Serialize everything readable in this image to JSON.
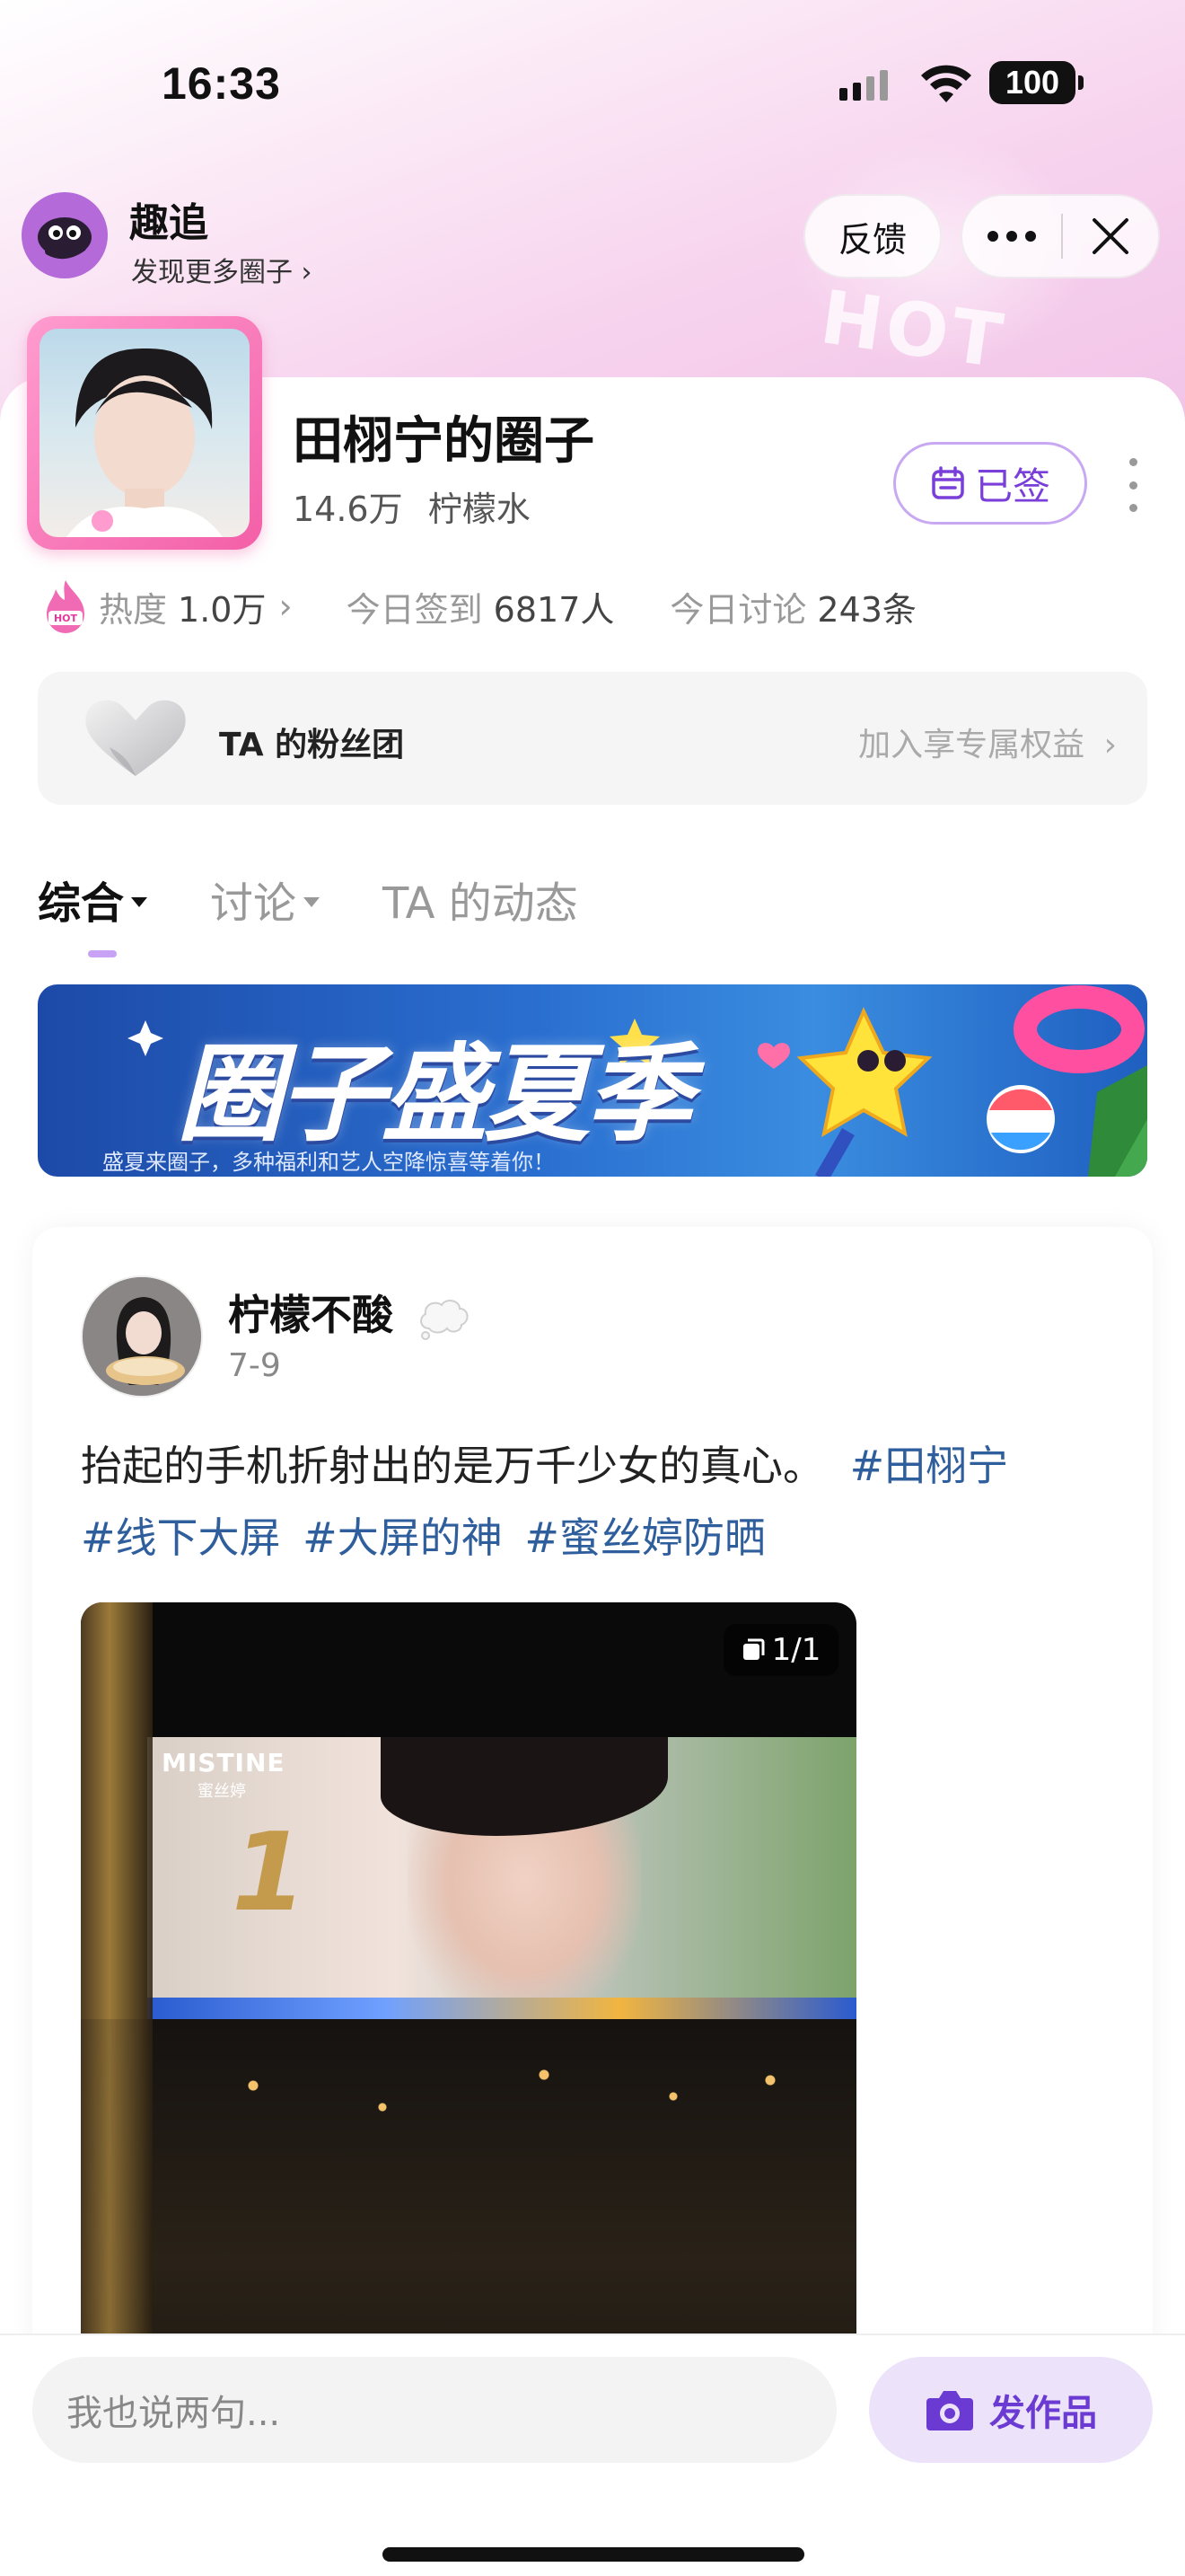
{
  "status_bar": {
    "time": "16:33",
    "battery": "100"
  },
  "mini_app": {
    "name": "趣追",
    "subtitle": "发现更多圈子",
    "feedback_label": "反馈"
  },
  "circle": {
    "title": "田栩宁的圈子",
    "members": "14.6万",
    "fan_name": "柠檬水",
    "signed_label": "已签"
  },
  "stats": {
    "heat_label": "热度",
    "heat_value": "1.0万",
    "checkin_label": "今日签到",
    "checkin_value": "6817人",
    "discussion_label": "今日讨论",
    "discussion_value": "243条"
  },
  "fan_club": {
    "label": "TA 的粉丝团",
    "action": "加入享专属权益"
  },
  "tabs": [
    {
      "label": "综合"
    },
    {
      "label": "讨论"
    },
    {
      "label": "TA 的动态"
    }
  ],
  "banner": {
    "title": "圈子盛夏季",
    "subtitle": "盛夏来圈子，多种福利和艺人空降惊喜等着你！"
  },
  "post": {
    "author": "柠檬不酸",
    "date": "7-9",
    "text": "抬起的手机折射出的是万千少女的真心。",
    "tags": [
      "#田栩宁",
      "#线下大屏",
      "#大屏的神",
      "#蜜丝婷防晒"
    ],
    "image_counter": "1/1",
    "image_brand": "MISTINE",
    "image_brand_cn": "蜜丝婷",
    "image_number": "1"
  },
  "bottom": {
    "comment_placeholder": "我也说两句...",
    "post_button": "发作品"
  },
  "colors": {
    "accent_purple": "#7a3fd8",
    "tag_blue": "#2f5e9c",
    "pink_frame": "#f35fa8"
  }
}
